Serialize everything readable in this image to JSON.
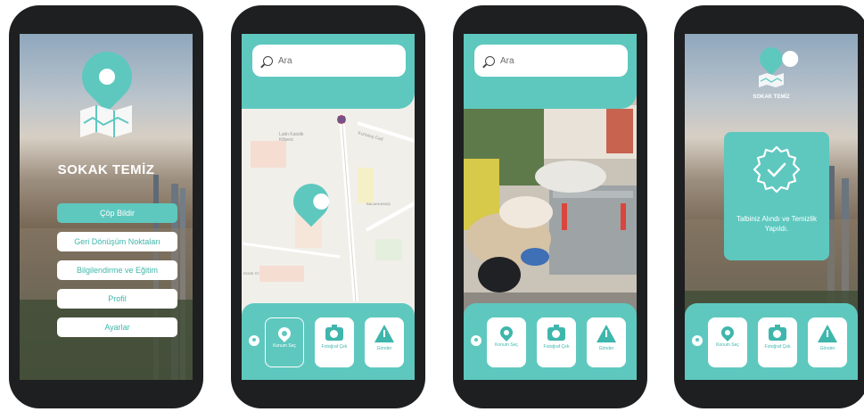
{
  "app": {
    "name": "SOKAK TEMİZ",
    "name_small": "SOKAK TEMİZ"
  },
  "welcome_menu": {
    "items": [
      "Çöp Bildir",
      "Geri Dönüşüm Noktaları",
      "Bilgilendirme ve Eğitim",
      "Profil",
      "Ayarlar"
    ]
  },
  "search": {
    "placeholder": "Ara"
  },
  "map_labels": [
    "Latin Katolik Kilisesi",
    "Kurtuluş Cad",
    "BALAKKAYAŞI",
    "ROSE ST"
  ],
  "actions": {
    "location": "Konum Seç",
    "photo": "Fotoğraf Çek",
    "send": "Gönder"
  },
  "confirmation": {
    "message": "Talbiniz Alındı ve Temizlik Yapıldı."
  },
  "colors": {
    "accent": "#5ec8bf",
    "accent_dark": "#3fb6ac",
    "phone_frame": "#1e1f20"
  }
}
